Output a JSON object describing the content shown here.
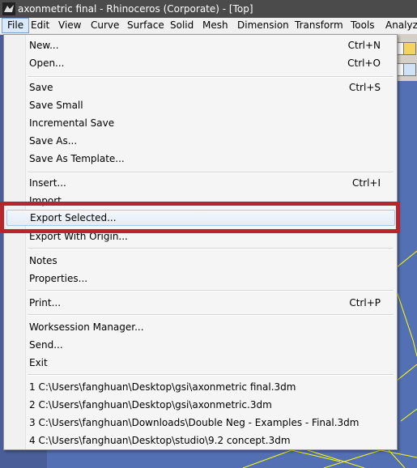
{
  "window": {
    "title": "axonmetric final - Rhinoceros (Corporate) - [Top]"
  },
  "menubar": [
    {
      "label": "File",
      "open": true
    },
    {
      "label": "Edit"
    },
    {
      "label": "View"
    },
    {
      "label": "Curve"
    },
    {
      "label": "Surface"
    },
    {
      "label": "Solid"
    },
    {
      "label": "Mesh"
    },
    {
      "label": "Dimension"
    },
    {
      "label": "Transform"
    },
    {
      "label": "Tools"
    },
    {
      "label": "Analyze"
    }
  ],
  "file_menu": {
    "items": [
      {
        "label": "New...",
        "shortcut": "Ctrl+N"
      },
      {
        "label": "Open...",
        "shortcut": "Ctrl+O"
      },
      {
        "label": "Save",
        "shortcut": "Ctrl+S"
      },
      {
        "label": "Save Small",
        "shortcut": ""
      },
      {
        "label": "Incremental Save",
        "shortcut": ""
      },
      {
        "label": "Save As...",
        "shortcut": ""
      },
      {
        "label": "Save As Template...",
        "shortcut": ""
      },
      {
        "label": "Insert...",
        "shortcut": "Ctrl+I"
      },
      {
        "label": "Import...",
        "shortcut": ""
      },
      {
        "label": "Export Selected...",
        "shortcut": "",
        "highlighted": true
      },
      {
        "label": "Export With Origin...",
        "shortcut": ""
      },
      {
        "label": "Notes",
        "shortcut": ""
      },
      {
        "label": "Properties...",
        "shortcut": ""
      },
      {
        "label": "Print...",
        "shortcut": "Ctrl+P"
      },
      {
        "label": "Worksession Manager...",
        "shortcut": ""
      },
      {
        "label": "Send...",
        "shortcut": ""
      },
      {
        "label": "Exit",
        "shortcut": ""
      }
    ],
    "recent_files": [
      "1 C:\\Users\\fanghuan\\Desktop\\gsi\\axonmetric final.3dm",
      "2 C:\\Users\\fanghuan\\Desktop\\gsi\\axonmetric.3dm",
      "3 C:\\Users\\fanghuan\\Downloads\\Double Neg - Examples - Final.3dm",
      "4 C:\\Users\\fanghuan\\Desktop\\studio\\9.2 concept.3dm"
    ]
  },
  "colors": {
    "highlight_box": "#b8262b",
    "viewport": "#5470b4",
    "wireframe": "#ffff00"
  }
}
